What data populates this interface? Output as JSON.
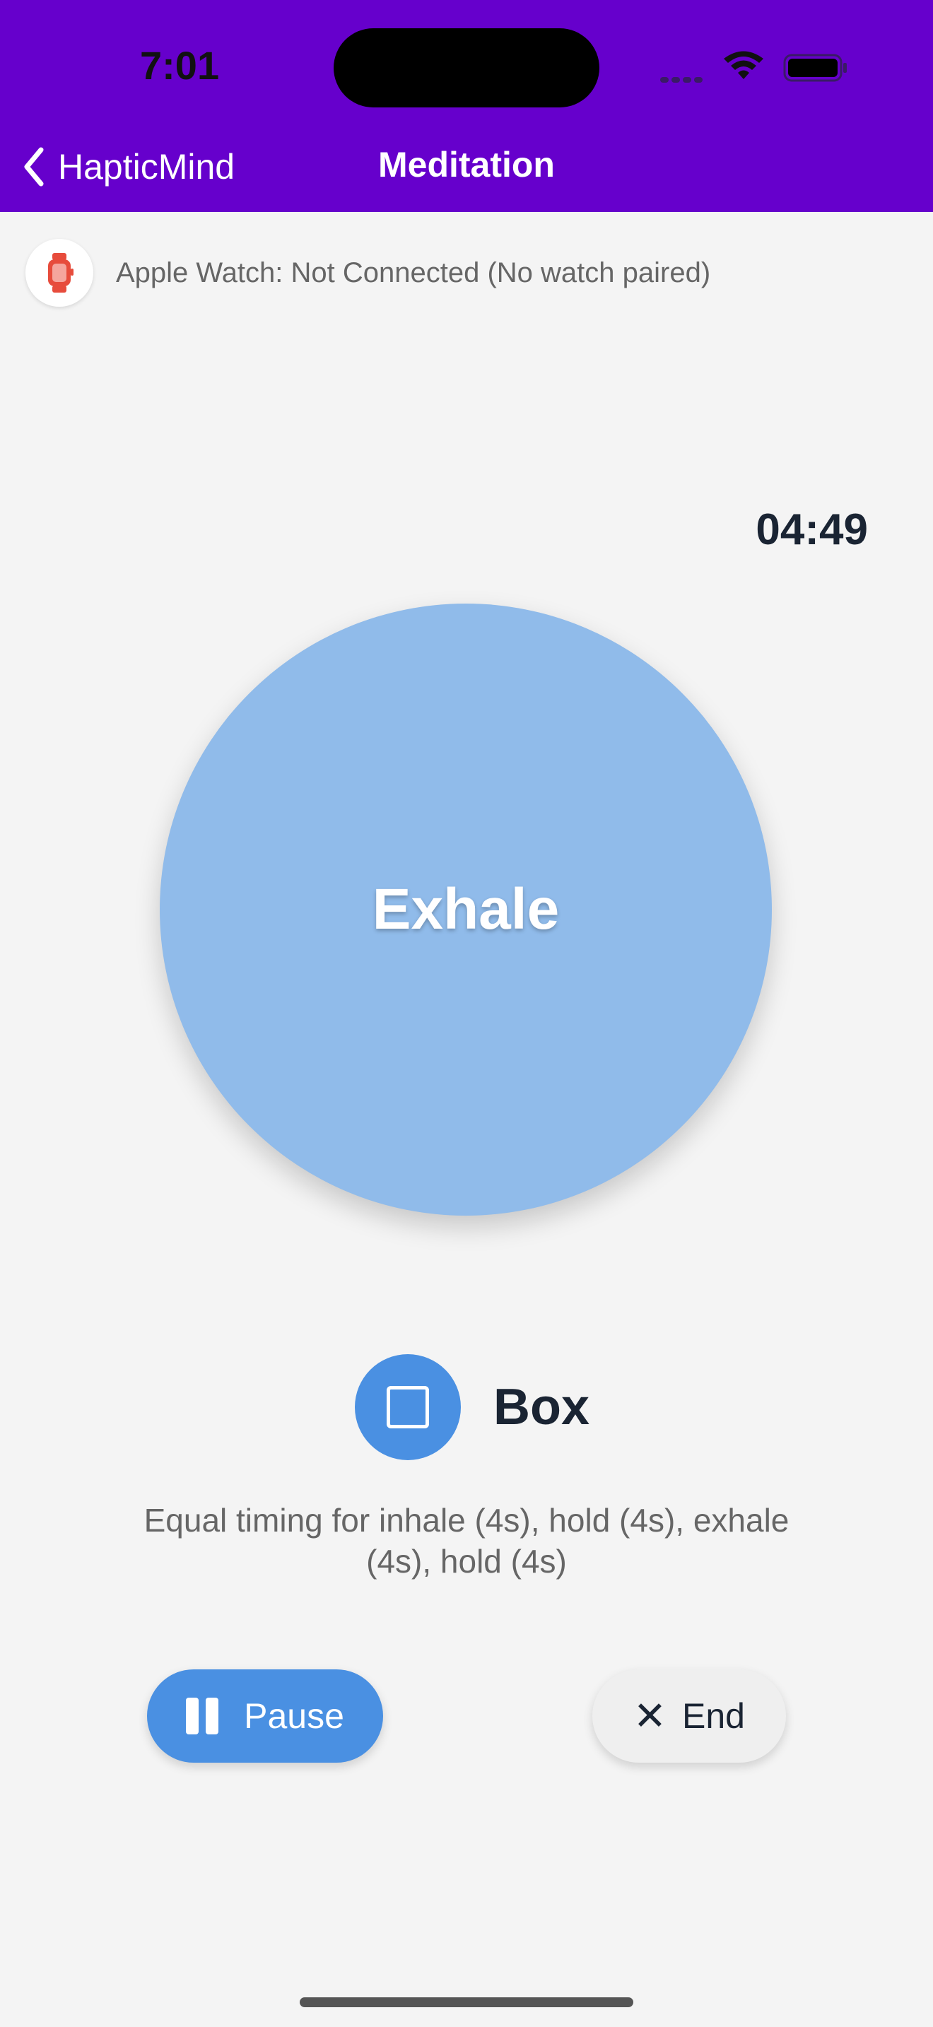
{
  "status_bar": {
    "time": "7:01"
  },
  "nav": {
    "back_label": "HapticMind",
    "title": "Meditation"
  },
  "watch_status": {
    "text": "Apple Watch: Not Connected (No watch paired)",
    "icon": "watch-icon",
    "icon_color": "#e74c3c"
  },
  "session": {
    "timer": "04:49",
    "phase": "Exhale",
    "pattern_name": "Box",
    "pattern_icon": "square-icon",
    "pattern_description": "Equal timing for inhale (4s), hold (4s), exhale (4s), hold (4s)"
  },
  "controls": {
    "pause_label": "Pause",
    "end_label": "End"
  },
  "colors": {
    "header": "#6600cc",
    "accent": "#4a90e2",
    "circle": "#90bbea",
    "background": "#f4f4f4"
  }
}
